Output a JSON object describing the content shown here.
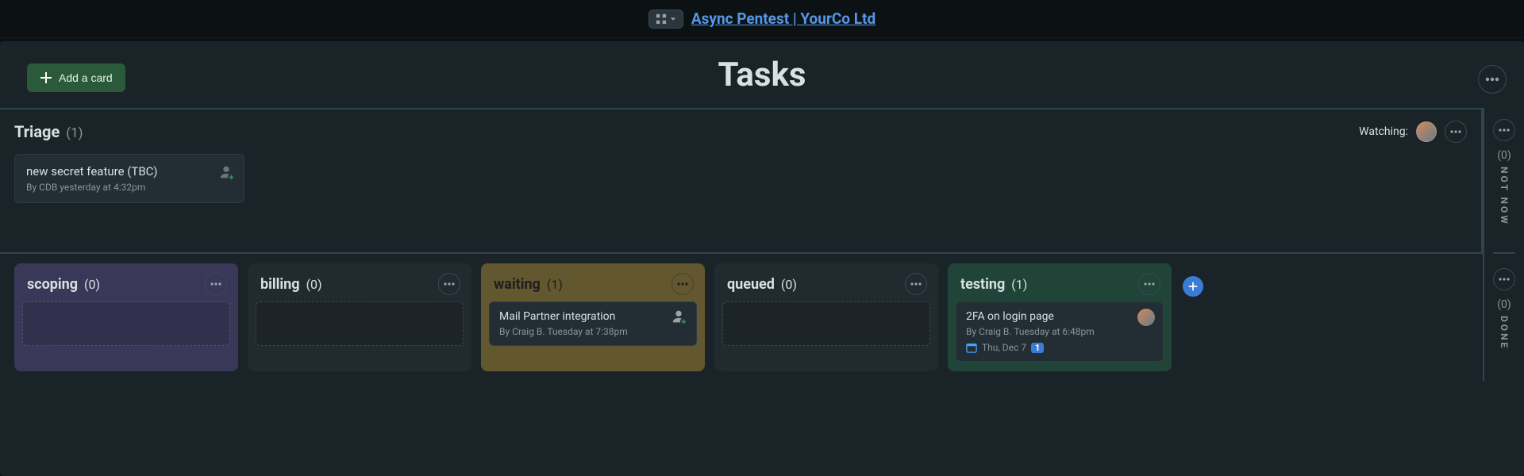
{
  "topbar": {
    "board_link": "Async Pentest | YourCo Ltd"
  },
  "header": {
    "add_card_label": "Add a card",
    "board_title": "Tasks"
  },
  "triage_row": {
    "title": "Triage",
    "count": "(1)",
    "watching_label": "Watching:",
    "card": {
      "title": "new secret feature (TBC)",
      "meta": "By CDB yesterday at 4:32pm"
    }
  },
  "side_row1": {
    "count": "(0)",
    "label": "NOT NOW"
  },
  "columns": [
    {
      "name": "scoping",
      "count": "(0)"
    },
    {
      "name": "billing",
      "count": "(0)"
    },
    {
      "name": "waiting",
      "count": "(1)",
      "card": {
        "title": "Mail Partner integration",
        "meta": "By Craig B. Tuesday at 7:38pm"
      }
    },
    {
      "name": "queued",
      "count": "(0)"
    },
    {
      "name": "testing",
      "count": "(1)",
      "card": {
        "title": "2FA on login page",
        "meta": "By Craig B. Tuesday at 6:48pm",
        "date": "Thu, Dec 7",
        "badge": "1"
      }
    }
  ],
  "side_row2": {
    "count": "(0)",
    "label": "DONE"
  }
}
